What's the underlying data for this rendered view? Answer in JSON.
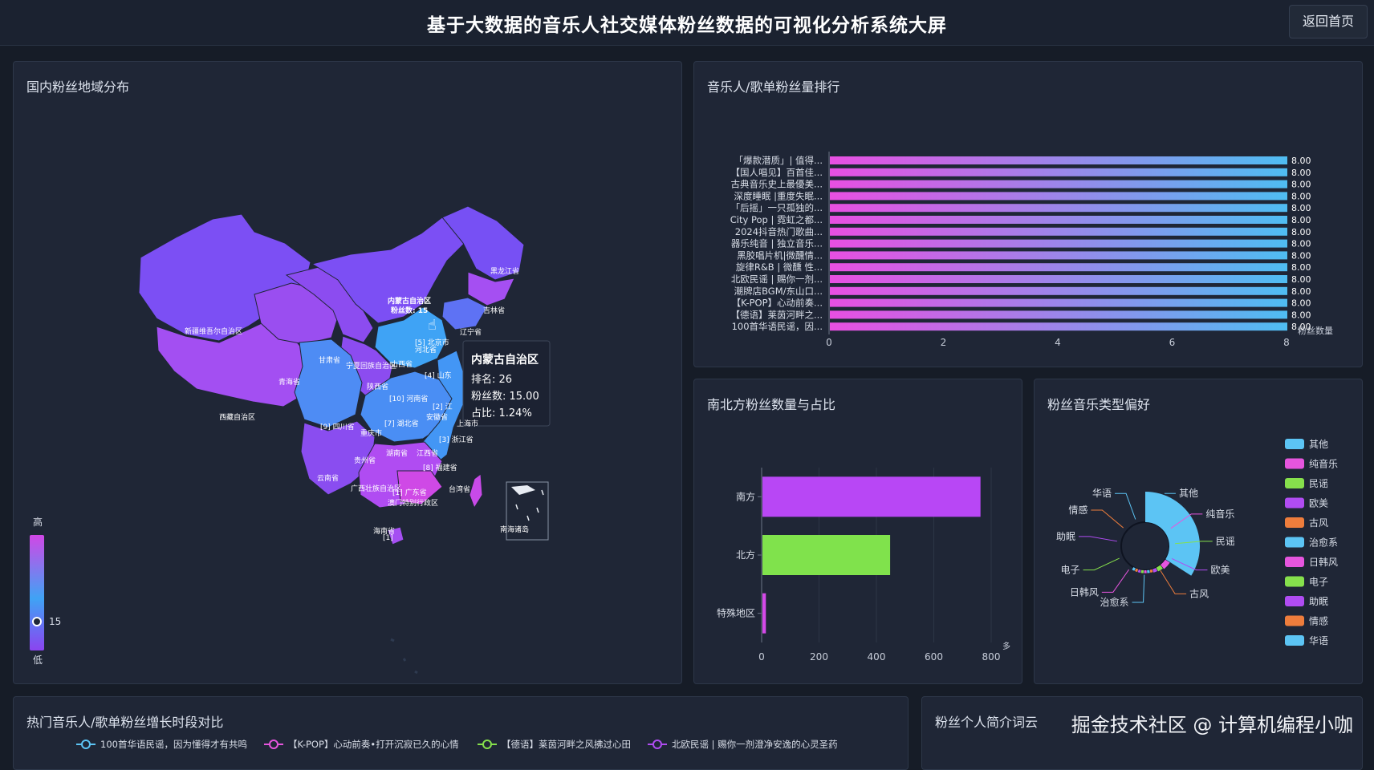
{
  "header": {
    "title": "基于大数据的音乐人社交媒体粉丝数据的可视化分析系统大屏",
    "back_label": "返回首页"
  },
  "map_panel": {
    "title": "国内粉丝地域分布",
    "visual_map": {
      "high": "高",
      "low": "低",
      "current": "15"
    },
    "labels": {
      "xinjiang": "新疆维吾尔自治区",
      "tibet": "西藏自治区",
      "qinghai": "青海省",
      "gansu": "甘肃省",
      "ningxia": "宁夏回族自治区",
      "neimenggu": "内蒙古自治区",
      "neimenggu_fans": "粉丝数: 15",
      "heilongjiang": "黑龙江省",
      "jilin": "吉林省",
      "liaoning": "辽宁省",
      "beijing": "[5] 北京市",
      "hebei": "河北省",
      "shanxi": "山西省",
      "shandong": "[4] 山东",
      "henan": "[10] 河南省",
      "shaanxi": "陕西省",
      "sichuan": "[9] 四川省",
      "chongqing": "重庆市",
      "hubei": "[7] 湖北省",
      "anhui": "安徽省",
      "jiangsu": "[2] 江",
      "shanghai": "上海市",
      "zhejiang": "[3] 浙江省",
      "hunan": "湖南省",
      "jiangxi": "江西省",
      "fujian": "[8] 福建省",
      "guizhou": "贵州省",
      "yunnan": "云南省",
      "guangxi": "广西壮族自治区",
      "guangdong": "[1] 广东省",
      "hkmacau": "澳门特别行政区",
      "taiwan": "台湾省",
      "hainan": "海南省",
      "south_sea": "南海诸岛",
      "south_marker": "[1]"
    },
    "tooltip": {
      "title": "内蒙古自治区",
      "rank": "排名: 26",
      "fans": "粉丝数: 15.00",
      "ratio": "占比: 1.24%"
    },
    "colors": {
      "high": "#d147e6",
      "low": "#8b44f0",
      "mid": "#3fa3f5"
    }
  },
  "ranking_panel": {
    "title": "音乐人/歌单粉丝量排行",
    "axis_name": "粉丝数量",
    "chart_data": {
      "type": "bar",
      "orientation": "horizontal",
      "categories": [
        "「爆款潜质」| 值得...",
        "【国人唱见】百首佳...",
        "古典音乐史上最優美...",
        "深度睡眠 |重度失眠...",
        "「后摇」一只孤独的...",
        "City Pop | 霓虹之都...",
        "2024抖音热门歌曲...",
        "器乐纯音 | 独立音乐...",
        "黑胶唱片机|微醺情...",
        "旋律R&B | 微醺 性...",
        "北欧民谣 | 赐你一剂...",
        "潮牌店BGM/东山口...",
        "【K-POP】心动前奏...",
        "【德语】莱茵河畔之...",
        "100首华语民谣，因..."
      ],
      "values": [
        8,
        8,
        8,
        8,
        8,
        8,
        8,
        8,
        8,
        8,
        8,
        8,
        8,
        8,
        8
      ],
      "value_labels": [
        "8.00",
        "8.00",
        "8.00",
        "8.00",
        "8.00",
        "8.00",
        "8.00",
        "8.00",
        "8.00",
        "8.00",
        "8.00",
        "8.00",
        "8.00",
        "8.00",
        "8.00"
      ],
      "x_ticks": [
        "0",
        "2",
        "4",
        "6",
        "8"
      ],
      "xlim": [
        0,
        8
      ],
      "gradient": [
        "#e84fe2",
        "#4fbdf2"
      ]
    }
  },
  "north_south_panel": {
    "title": "南北方粉丝数量与占比",
    "axis_unit": "多",
    "chart_data": {
      "type": "bar",
      "orientation": "horizontal",
      "categories": [
        "南方",
        "北方",
        "特殊地区"
      ],
      "values": [
        760,
        445,
        12
      ],
      "colors": [
        "#b847f5",
        "#80e24c",
        "#d449e8"
      ],
      "x_ticks": [
        "0",
        "200",
        "400",
        "600",
        "800"
      ],
      "xlim": [
        0,
        800
      ]
    }
  },
  "genre_panel": {
    "title": "粉丝音乐类型偏好",
    "chart_data": {
      "type": "pie",
      "categories": [
        "其他",
        "纯音乐",
        "民谣",
        "欧美",
        "古风",
        "治愈系",
        "日韩风",
        "电子",
        "助眠",
        "情感",
        "华语"
      ],
      "values": [
        22,
        3,
        2,
        1.5,
        1,
        1,
        1,
        1,
        1,
        1,
        1
      ],
      "colors": [
        "#5cc4f4",
        "#e655de",
        "#86e04c",
        "#b04cf2",
        "#ee7d3c",
        "#5cc4f4",
        "#e655de",
        "#86e04c",
        "#b04cf2",
        "#ee7d3c",
        "#5cc4f4"
      ]
    }
  },
  "growth_panel": {
    "title": "热门音乐人/歌单粉丝增长时段对比",
    "legend": [
      {
        "label": "100首华语民谣，因为懂得才有共鸣",
        "color": "#5cc4f4"
      },
      {
        "label": "【K-POP】心动前奏•打开沉寂已久的心情",
        "color": "#e655de"
      },
      {
        "label": "【德语】莱茵河畔之风拂过心田",
        "color": "#86e04c"
      },
      {
        "label": "北欧民谣 | 赐你一剂澄净安逸的心灵圣药",
        "color": "#b04cf2"
      }
    ]
  },
  "wordcloud_panel": {
    "title": "粉丝个人简介词云"
  },
  "watermark": "掘金技术社区 @ 计算机编程小咖"
}
